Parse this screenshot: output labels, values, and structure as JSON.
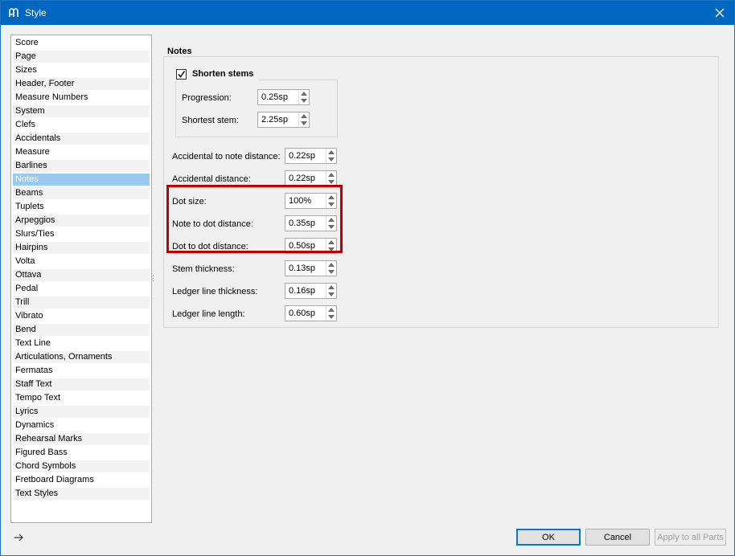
{
  "window": {
    "title": "Style",
    "accent_color": "#0067c0"
  },
  "sidebar": {
    "items": [
      {
        "label": "Score"
      },
      {
        "label": "Page"
      },
      {
        "label": "Sizes"
      },
      {
        "label": "Header, Footer"
      },
      {
        "label": "Measure Numbers"
      },
      {
        "label": "System"
      },
      {
        "label": "Clefs"
      },
      {
        "label": "Accidentals"
      },
      {
        "label": "Measure"
      },
      {
        "label": "Barlines"
      },
      {
        "label": "Notes",
        "selected": true
      },
      {
        "label": "Beams"
      },
      {
        "label": "Tuplets"
      },
      {
        "label": "Arpeggios"
      },
      {
        "label": "Slurs/Ties"
      },
      {
        "label": "Hairpins"
      },
      {
        "label": "Volta"
      },
      {
        "label": "Ottava"
      },
      {
        "label": "Pedal"
      },
      {
        "label": "Trill"
      },
      {
        "label": "Vibrato"
      },
      {
        "label": "Bend"
      },
      {
        "label": "Text Line"
      },
      {
        "label": "Articulations, Ornaments"
      },
      {
        "label": "Fermatas"
      },
      {
        "label": "Staff Text"
      },
      {
        "label": "Tempo Text"
      },
      {
        "label": "Lyrics"
      },
      {
        "label": "Dynamics"
      },
      {
        "label": "Rehearsal Marks"
      },
      {
        "label": "Figured Bass"
      },
      {
        "label": "Chord Symbols"
      },
      {
        "label": "Fretboard Diagrams"
      },
      {
        "label": "Text Styles"
      }
    ],
    "selected_color": "#99c9ef"
  },
  "notes": {
    "group_title": "Notes",
    "shorten_stems": {
      "label": "Shorten stems",
      "checked": true,
      "progression_label": "Progression:",
      "progression_value": "0.25sp",
      "shortest_label": "Shortest stem:",
      "shortest_value": "2.25sp"
    },
    "fields": [
      {
        "label": "Accidental to note distance:",
        "value": "0.22sp"
      },
      {
        "label": "Accidental distance:",
        "value": "0.22sp"
      },
      {
        "label": "Dot size:",
        "value": "100%"
      },
      {
        "label": "Note to dot distance:",
        "value": "0.35sp"
      },
      {
        "label": "Dot to dot distance:",
        "value": "0.50sp"
      },
      {
        "label": "Stem thickness:",
        "value": "0.13sp"
      },
      {
        "label": "Ledger line thickness:",
        "value": "0.16sp"
      },
      {
        "label": "Ledger line length:",
        "value": "0.60sp"
      }
    ],
    "highlight_color": "#c00000"
  },
  "footer": {
    "ok_label": "OK",
    "cancel_label": "Cancel",
    "apply_label": "Apply to all Parts"
  }
}
